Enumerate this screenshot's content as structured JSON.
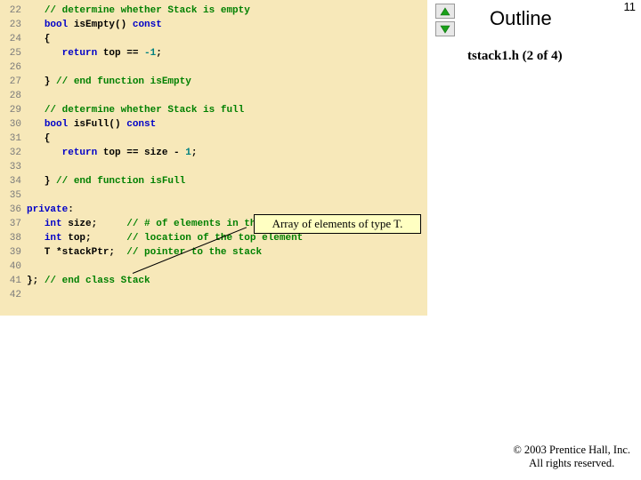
{
  "page_number": "11",
  "outline_label": "Outline",
  "file_label": "tstack1.h (2 of 4)",
  "callout_text": "Array of elements of type T.",
  "copyright_line1": "© 2003 Prentice Hall, Inc.",
  "copyright_line2": "All rights reserved.",
  "code_lines": [
    {
      "n": "22",
      "segs": [
        {
          "t": "   "
        },
        {
          "t": "// determine whether Stack is empty",
          "c": "cmt"
        }
      ]
    },
    {
      "n": "23",
      "segs": [
        {
          "t": "   "
        },
        {
          "t": "bool",
          "c": "kw"
        },
        {
          "t": " isEmpty() "
        },
        {
          "t": "const",
          "c": "kw"
        }
      ]
    },
    {
      "n": "24",
      "segs": [
        {
          "t": "   {"
        }
      ]
    },
    {
      "n": "25",
      "segs": [
        {
          "t": "      "
        },
        {
          "t": "return",
          "c": "kw"
        },
        {
          "t": " top == "
        },
        {
          "t": "-1",
          "c": "num"
        },
        {
          "t": ";"
        }
      ]
    },
    {
      "n": "26",
      "segs": [
        {
          "t": ""
        }
      ]
    },
    {
      "n": "27",
      "segs": [
        {
          "t": "   } "
        },
        {
          "t": "// end function isEmpty",
          "c": "cmt"
        }
      ]
    },
    {
      "n": "28",
      "segs": [
        {
          "t": ""
        }
      ]
    },
    {
      "n": "29",
      "segs": [
        {
          "t": "   "
        },
        {
          "t": "// determine whether Stack is full",
          "c": "cmt"
        }
      ]
    },
    {
      "n": "30",
      "segs": [
        {
          "t": "   "
        },
        {
          "t": "bool",
          "c": "kw"
        },
        {
          "t": " isFull() "
        },
        {
          "t": "const",
          "c": "kw"
        }
      ]
    },
    {
      "n": "31",
      "segs": [
        {
          "t": "   {"
        }
      ]
    },
    {
      "n": "32",
      "segs": [
        {
          "t": "      "
        },
        {
          "t": "return",
          "c": "kw"
        },
        {
          "t": " top == size - "
        },
        {
          "t": "1",
          "c": "num"
        },
        {
          "t": ";"
        }
      ]
    },
    {
      "n": "33",
      "segs": [
        {
          "t": ""
        }
      ]
    },
    {
      "n": "34",
      "segs": [
        {
          "t": "   } "
        },
        {
          "t": "// end function isFull",
          "c": "cmt"
        }
      ]
    },
    {
      "n": "35",
      "segs": [
        {
          "t": ""
        }
      ]
    },
    {
      "n": "36",
      "segs": [
        {
          "t": "private",
          "c": "kw"
        },
        {
          "t": ":"
        }
      ]
    },
    {
      "n": "37",
      "segs": [
        {
          "t": "   "
        },
        {
          "t": "int",
          "c": "kw"
        },
        {
          "t": " size;     "
        },
        {
          "t": "// # of elements in the stack",
          "c": "cmt"
        }
      ]
    },
    {
      "n": "38",
      "segs": [
        {
          "t": "   "
        },
        {
          "t": "int",
          "c": "kw"
        },
        {
          "t": " top;      "
        },
        {
          "t": "// location of the top element",
          "c": "cmt"
        }
      ]
    },
    {
      "n": "39",
      "segs": [
        {
          "t": "   T *stackPtr;  "
        },
        {
          "t": "// pointer to the stack",
          "c": "cmt"
        }
      ]
    },
    {
      "n": "40",
      "segs": [
        {
          "t": ""
        }
      ]
    },
    {
      "n": "41",
      "segs": [
        {
          "t": "}; "
        },
        {
          "t": "// end class Stack",
          "c": "cmt"
        }
      ]
    },
    {
      "n": "42",
      "segs": [
        {
          "t": ""
        }
      ]
    }
  ]
}
